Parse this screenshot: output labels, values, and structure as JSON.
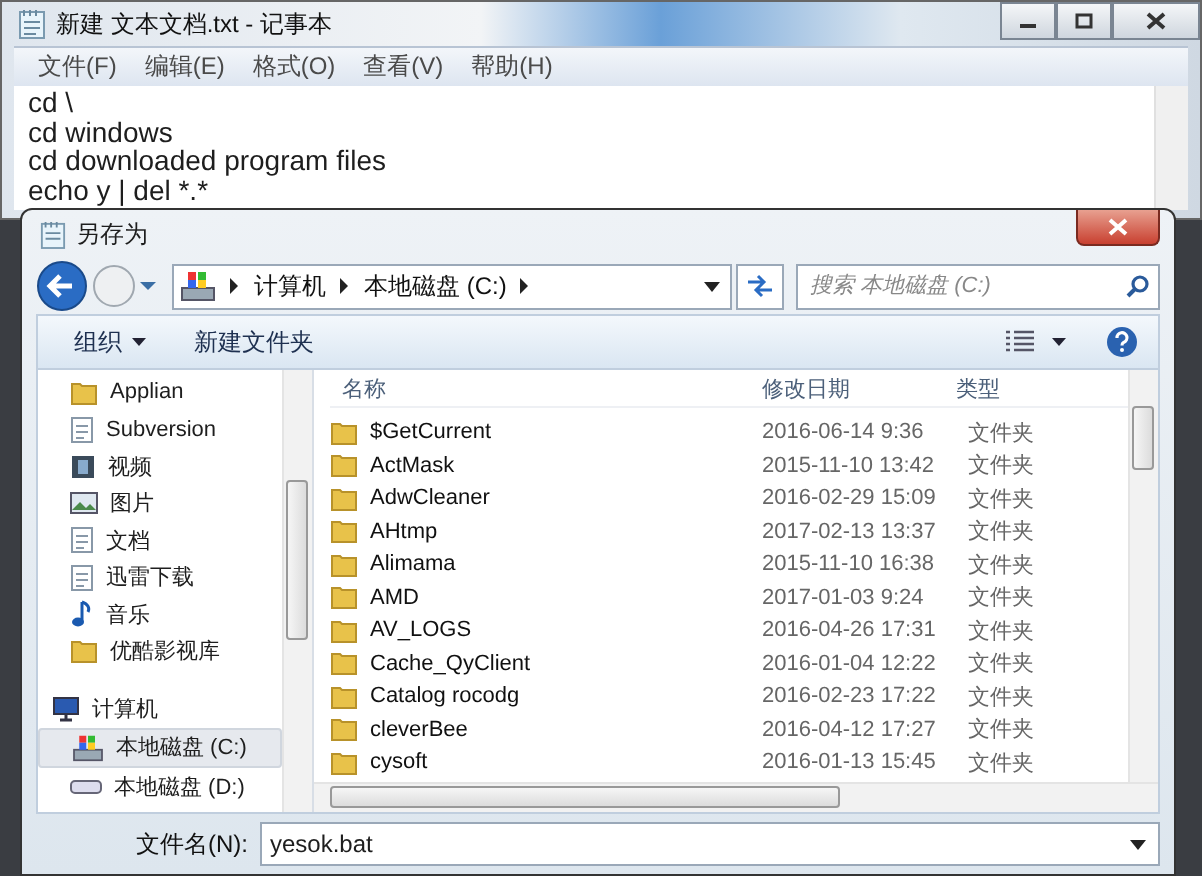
{
  "notepad": {
    "title": "新建 文本文档.txt - 记事本",
    "menu": [
      "文件(F)",
      "编辑(E)",
      "格式(O)",
      "查看(V)",
      "帮助(H)"
    ],
    "lines": [
      "cd \\",
      "cd windows",
      "cd downloaded program files",
      "echo y | del *.*"
    ]
  },
  "dialog": {
    "title": "另存为",
    "breadcrumb": [
      "计算机",
      "本地磁盘 (C:)"
    ],
    "search": {
      "placeholder": "搜索 本地磁盘 (C:)"
    },
    "toolbar": {
      "organize": "组织",
      "new_folder": "新建文件夹"
    },
    "nav": [
      {
        "label": "Applian",
        "kind": "folder",
        "selected": false
      },
      {
        "label": "Subversion",
        "kind": "document",
        "selected": false
      },
      {
        "label": "视频",
        "kind": "video",
        "selected": false
      },
      {
        "label": "图片",
        "kind": "picture",
        "selected": false
      },
      {
        "label": "文档",
        "kind": "document",
        "selected": false
      },
      {
        "label": "迅雷下载",
        "kind": "document",
        "selected": false
      },
      {
        "label": "音乐",
        "kind": "music",
        "selected": false
      },
      {
        "label": "优酷影视库",
        "kind": "folder",
        "selected": false
      },
      {
        "label": "计算机",
        "kind": "computer",
        "selected": false
      },
      {
        "label": "本地磁盘 (C:)",
        "kind": "sysdrive",
        "selected": true
      },
      {
        "label": "本地磁盘 (D:)",
        "kind": "drive",
        "selected": false
      }
    ],
    "columns": [
      "名称",
      "修改日期",
      "类型"
    ],
    "rows": [
      {
        "name": "$GetCurrent",
        "date": "2016-06-14 9:36",
        "type": "文件夹"
      },
      {
        "name": "ActMask",
        "date": "2015-11-10 13:42",
        "type": "文件夹"
      },
      {
        "name": "AdwCleaner",
        "date": "2016-02-29 15:09",
        "type": "文件夹"
      },
      {
        "name": "AHtmp",
        "date": "2017-02-13 13:37",
        "type": "文件夹"
      },
      {
        "name": "Alimama",
        "date": "2015-11-10 16:38",
        "type": "文件夹"
      },
      {
        "name": "AMD",
        "date": "2017-01-03 9:24",
        "type": "文件夹"
      },
      {
        "name": "AV_LOGS",
        "date": "2016-04-26 17:31",
        "type": "文件夹"
      },
      {
        "name": "Cache_QyClient",
        "date": "2016-01-04 12:22",
        "type": "文件夹"
      },
      {
        "name": "Catalog rocodg",
        "date": "2016-02-23 17:22",
        "type": "文件夹"
      },
      {
        "name": "cleverBee",
        "date": "2016-04-12 17:27",
        "type": "文件夹"
      },
      {
        "name": "cysoft",
        "date": "2016-01-13 15:45",
        "type": "文件夹"
      }
    ],
    "filename": {
      "label": "文件名(N):",
      "value": "yesok.bat"
    }
  }
}
